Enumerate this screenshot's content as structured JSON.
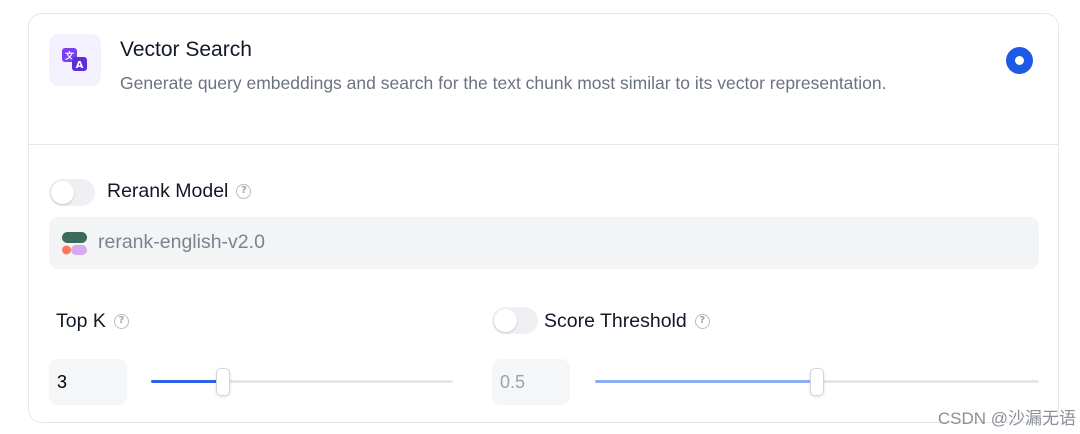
{
  "method": {
    "title": "Vector Search",
    "description": "Generate query embeddings and search for the text chunk most similar to its vector representation.",
    "icon": "translate-icon",
    "selected": true,
    "accent_color": "#1d5be6"
  },
  "rerank": {
    "label": "Rerank Model",
    "enabled": false,
    "help_icon": "question-circle-icon",
    "model": {
      "name": "rerank-english-v2.0",
      "logo_icon": "cohere-logo-icon"
    }
  },
  "top_k": {
    "label": "Top K",
    "value": "3",
    "slider_fraction": 0.24,
    "fill_color": "#2a64ec",
    "help_icon": "question-circle-icon"
  },
  "score_threshold": {
    "label": "Score Threshold",
    "enabled": false,
    "value": "0.5",
    "slider_fraction": 0.5,
    "fill_color": "#8aadf4",
    "help_icon": "question-circle-icon"
  },
  "watermark": "CSDN @沙漏无语"
}
